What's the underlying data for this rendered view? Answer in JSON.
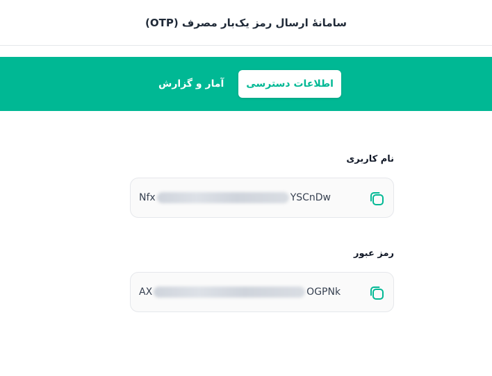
{
  "header": {
    "title": "سامانهٔ ارسال رمز یک‌بار مصرف (OTP)"
  },
  "tabs": [
    {
      "label": "اطلاعات دسترسی",
      "active": true
    },
    {
      "label": "آمار و گزارش",
      "active": false
    }
  ],
  "fields": {
    "username": {
      "label": "نام کاربری",
      "value_prefix": "Nfx",
      "value_suffix": "YSCnDw",
      "masked": true
    },
    "password": {
      "label": "رمز عبور",
      "value_prefix": "AX",
      "value_suffix": "OGPNk",
      "masked": true
    }
  },
  "icons": {
    "copy": "copy-icon"
  },
  "colors": {
    "primary": "#00b894",
    "header_text": "#1f2937",
    "tab_active_text": "#00b894"
  }
}
